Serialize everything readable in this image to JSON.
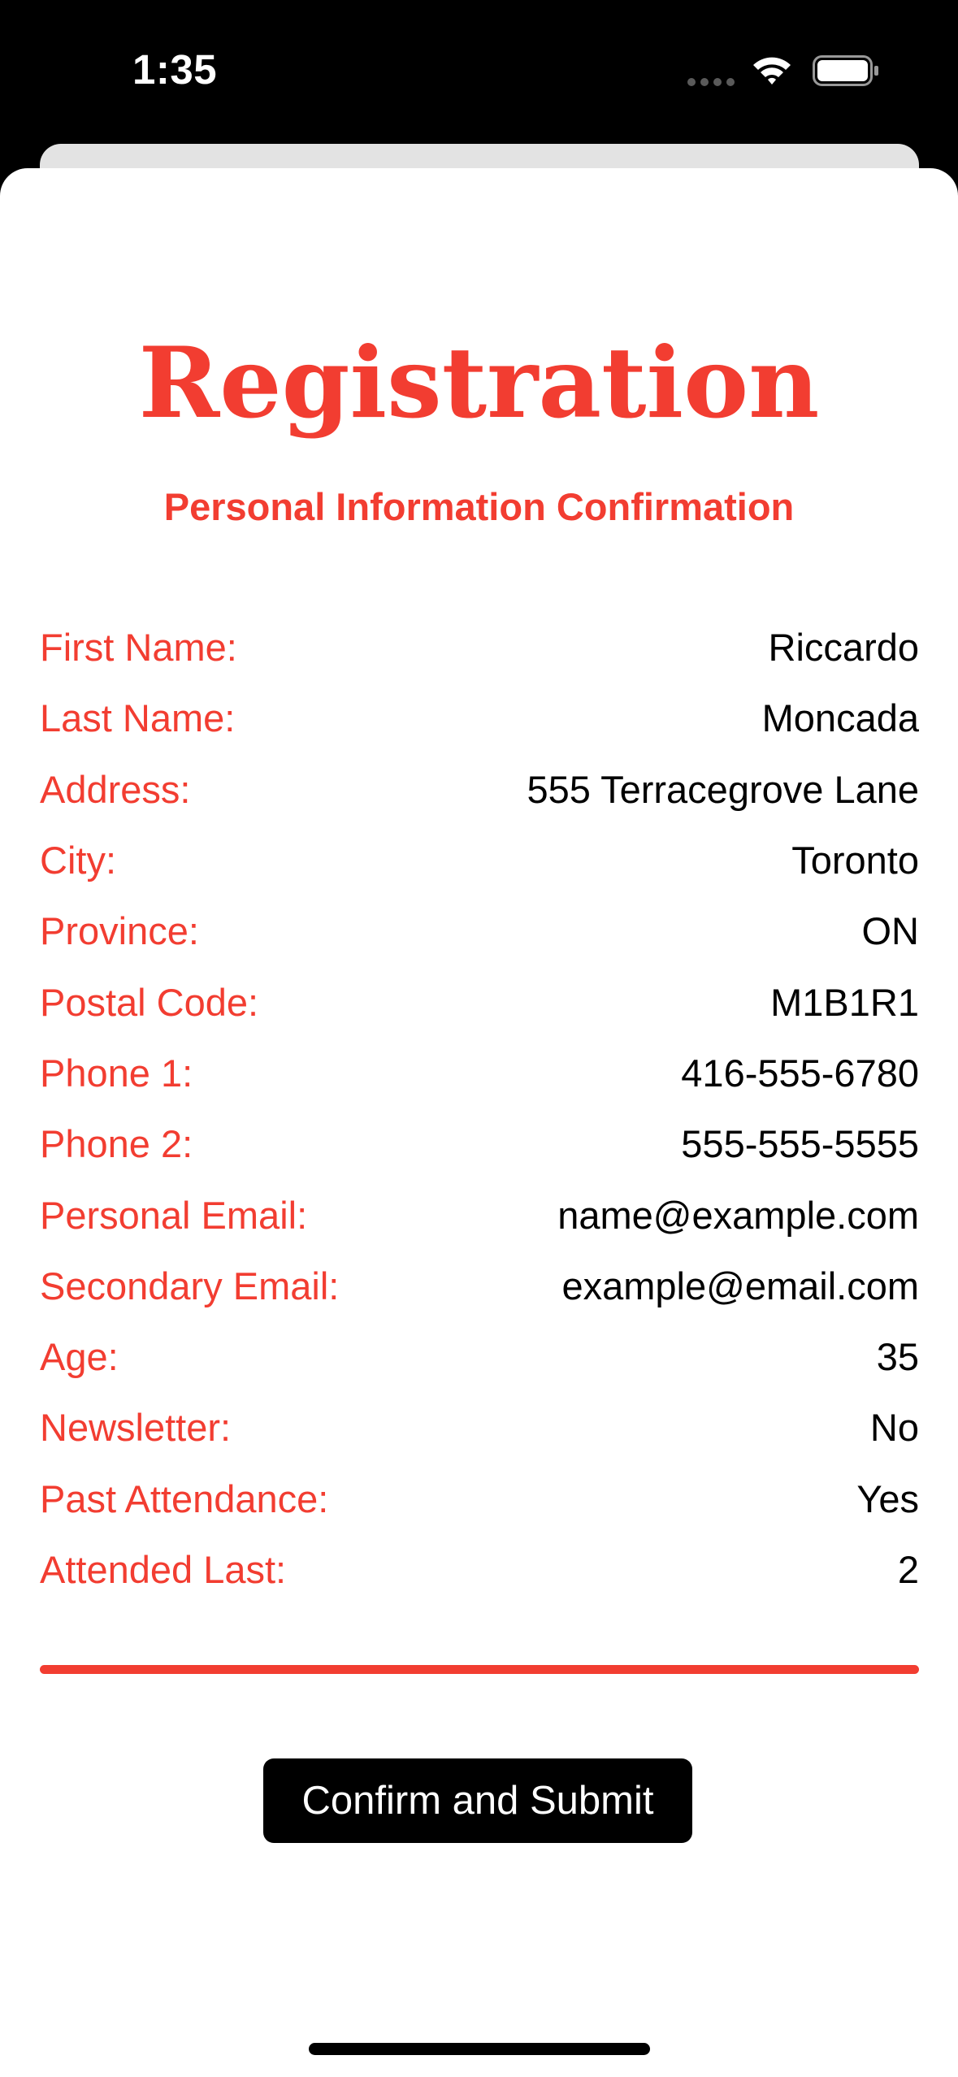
{
  "status_bar": {
    "time": "1:35",
    "icons": [
      "cellular-signal-icon",
      "wifi-icon",
      "battery-icon"
    ]
  },
  "header": {
    "title": "Registration",
    "subtitle": "Personal Information Confirmation"
  },
  "fields": [
    {
      "label": "First Name:",
      "value": "Riccardo"
    },
    {
      "label": "Last Name:",
      "value": "Moncada"
    },
    {
      "label": "Address:",
      "value": "555 Terracegrove Lane"
    },
    {
      "label": "City:",
      "value": "Toronto"
    },
    {
      "label": "Province:",
      "value": "ON"
    },
    {
      "label": "Postal Code:",
      "value": "M1B1R1"
    },
    {
      "label": "Phone 1:",
      "value": "416-555-6780"
    },
    {
      "label": "Phone 2:",
      "value": "555-555-5555"
    },
    {
      "label": "Personal Email:",
      "value": "name@example.com"
    },
    {
      "label": "Secondary Email:",
      "value": "example@email.com"
    },
    {
      "label": "Age:",
      "value": "35"
    },
    {
      "label": "Newsletter:",
      "value": "No"
    },
    {
      "label": "Past Attendance:",
      "value": "Yes"
    },
    {
      "label": "Attended Last:",
      "value": "2"
    }
  ],
  "actions": {
    "submit_label": "Confirm and Submit"
  },
  "colors": {
    "accent": "#f23d31",
    "text": "#000000",
    "background": "#ffffff",
    "button_background": "#000000",
    "button_text": "#ffffff"
  }
}
